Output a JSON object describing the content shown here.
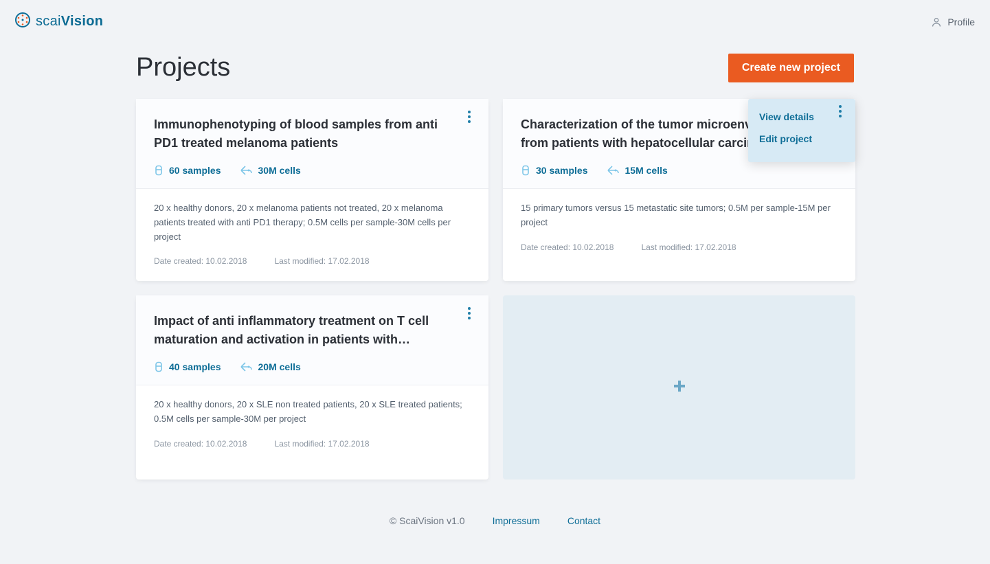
{
  "header": {
    "brand_prefix": "scai",
    "brand_bold": "Vision",
    "profile_label": "Profile"
  },
  "page": {
    "title": "Projects",
    "create_label": "Create new project"
  },
  "menu": {
    "view_details": "View details",
    "edit_project": "Edit project"
  },
  "footer": {
    "copyright": "© ScaiVision v1.0",
    "impressum": "Impressum",
    "contact": "Contact"
  },
  "projects": [
    {
      "title": "Immunophenotyping of blood samples from anti PD1 treated melanoma patients",
      "samples_label": "60 samples",
      "cells_label": "30M cells",
      "description": "20 x healthy donors, 20 x melanoma patients not treated, 20 x melanoma patients treated with anti PD1 therapy; 0.5M cells per sample-30M cells per project",
      "created_label": "Date created: 10.02.2018",
      "modified_label": "Last modified: 17.02.2018"
    },
    {
      "title": "Characterization of the tumor microenvironment from patients with hepatocellular carcinoma",
      "samples_label": "30 samples",
      "cells_label": "15M cells",
      "description": "15 primary tumors versus 15 metastatic site tumors; 0.5M per sample-15M per project",
      "created_label": "Date created: 10.02.2018",
      "modified_label": "Last modified: 17.02.2018"
    },
    {
      "title": "Impact of anti inflammatory treatment on T cell maturation and activation in patients with…",
      "samples_label": "40 samples",
      "cells_label": "20M cells",
      "description": "20 x healthy donors, 20 x SLE non treated patients, 20 x SLE treated patients; 0.5M cells per sample-30M per project",
      "created_label": "Date created: 10.02.2018",
      "modified_label": "Last modified: 17.02.2018"
    }
  ]
}
